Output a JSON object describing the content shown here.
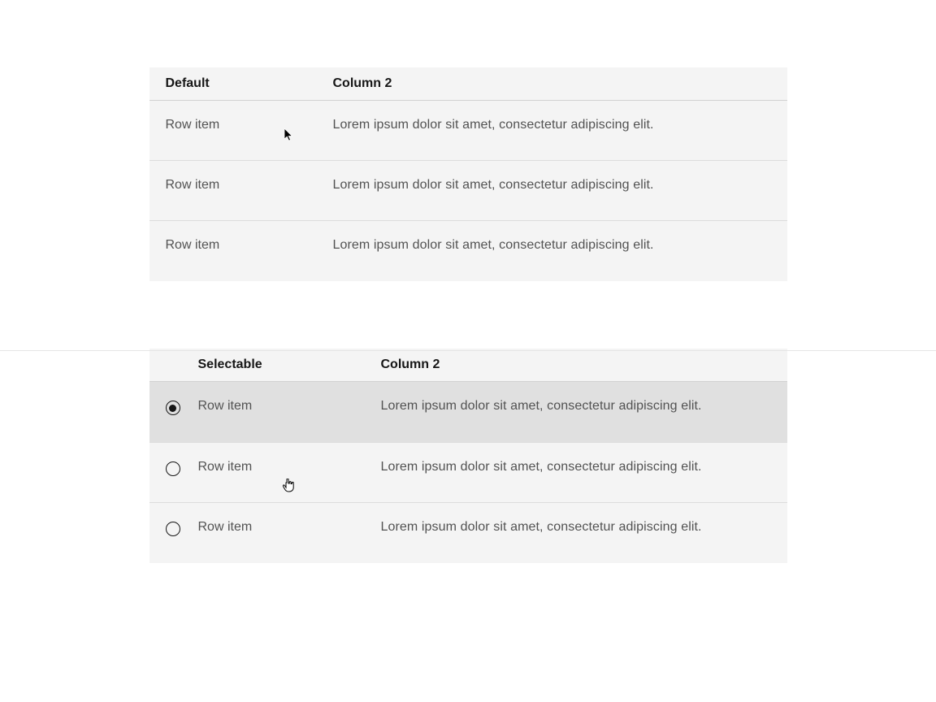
{
  "table1": {
    "headers": [
      "Default",
      "Column 2"
    ],
    "rows": [
      {
        "col1": "Row item",
        "col2": "Lorem ipsum dolor sit amet, consectetur adipiscing elit."
      },
      {
        "col1": "Row item",
        "col2": "Lorem ipsum dolor sit amet, consectetur adipiscing elit."
      },
      {
        "col1": "Row item",
        "col2": "Lorem ipsum dolor sit amet, consectetur adipiscing elit."
      }
    ]
  },
  "table2": {
    "headers": [
      "Selectable",
      "Column 2"
    ],
    "rows": [
      {
        "col1": "Row item",
        "col2": "Lorem ipsum dolor sit amet, consectetur adipiscing elit.",
        "selected": true
      },
      {
        "col1": "Row item",
        "col2": "Lorem ipsum dolor sit amet, consectetur adipiscing elit.",
        "selected": false
      },
      {
        "col1": "Row item",
        "col2": "Lorem ipsum dolor sit amet, consectetur adipiscing elit.",
        "selected": false
      }
    ]
  }
}
